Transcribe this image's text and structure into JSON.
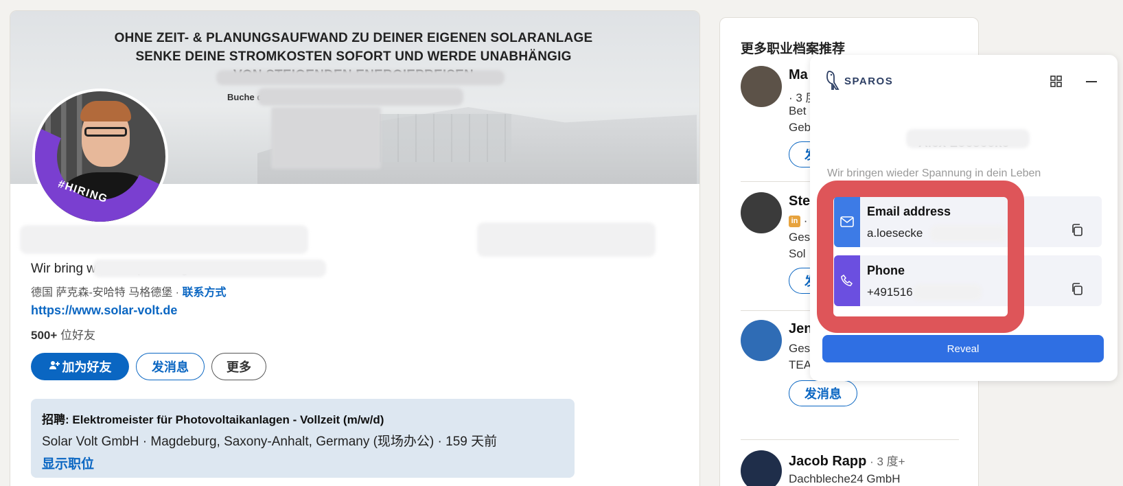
{
  "banner": {
    "line1": "OHNE ZEIT- & PLANUNGSAUFWAND ZU DEINER EIGENEN SOLARANLAGE",
    "line2": "SENKE DEINE STROMKOSTEN SOFORT UND WERDE UNABHÄNGIG",
    "line3": "VON STEIGENDEN ENERGIEPREISEN",
    "small": "Buche di                                       espräch"
  },
  "profile": {
    "hiring_badge": "#HIRING",
    "name": "Al",
    "headline": "Wir bring     wieder Spannung in dein Leben⚡",
    "location": "德国 萨克森-安哈特 马格德堡 · ",
    "contact_link": "联系方式",
    "website": "https://www.solar-volt.de",
    "connections_count": "500+",
    "connections_label": " 位好友",
    "buttons": {
      "connect": "加为好友",
      "message": "发消息",
      "more": "更多"
    },
    "company_suffix": "...H GmbH"
  },
  "job": {
    "title": "招聘: Elektromeister für Photovoltaikanlagen - Vollzeit (m/w/d)",
    "meta": "Solar Volt GmbH · Magdeburg, Saxony-Anhalt, Germany (现场办公) · 159 天前",
    "link": "显示职位"
  },
  "sidebar": {
    "title": "更多职业档案推荐",
    "people": [
      {
        "name": "Ma",
        "degree": "",
        "line1": "· 3 度+",
        "line2": "Bet",
        "line3": "Geb",
        "button": "发消息"
      },
      {
        "name": "Ste",
        "degree": "",
        "line1": "·",
        "line2": "Ges",
        "line3": "Sol",
        "button": "发消息"
      },
      {
        "name": "Jen",
        "degree": "",
        "line1": "Ges",
        "line2": "TEAM International GmbH",
        "line3": "",
        "button": "发消息"
      },
      {
        "name": "Jacob Rapp",
        "degree": " · 3 度+",
        "line1": "Dachbleche24 GmbH",
        "line2": "",
        "line3": "",
        "button": ""
      }
    ]
  },
  "sparos": {
    "brand": "SPAROS",
    "name": "Alex                Loesecke",
    "headline": "Wir bringen wieder Spannung in dein Leben",
    "email_label": "Email address",
    "email_value": "a.loesecke",
    "phone_label": "Phone",
    "phone_value": "+491516",
    "reveal": "Reveal",
    "colors": {
      "email_stripe": "#3d7be6",
      "phone_stripe": "#6b4fe0",
      "reveal": "#2f6fe3",
      "highlight": "#de5559"
    }
  }
}
